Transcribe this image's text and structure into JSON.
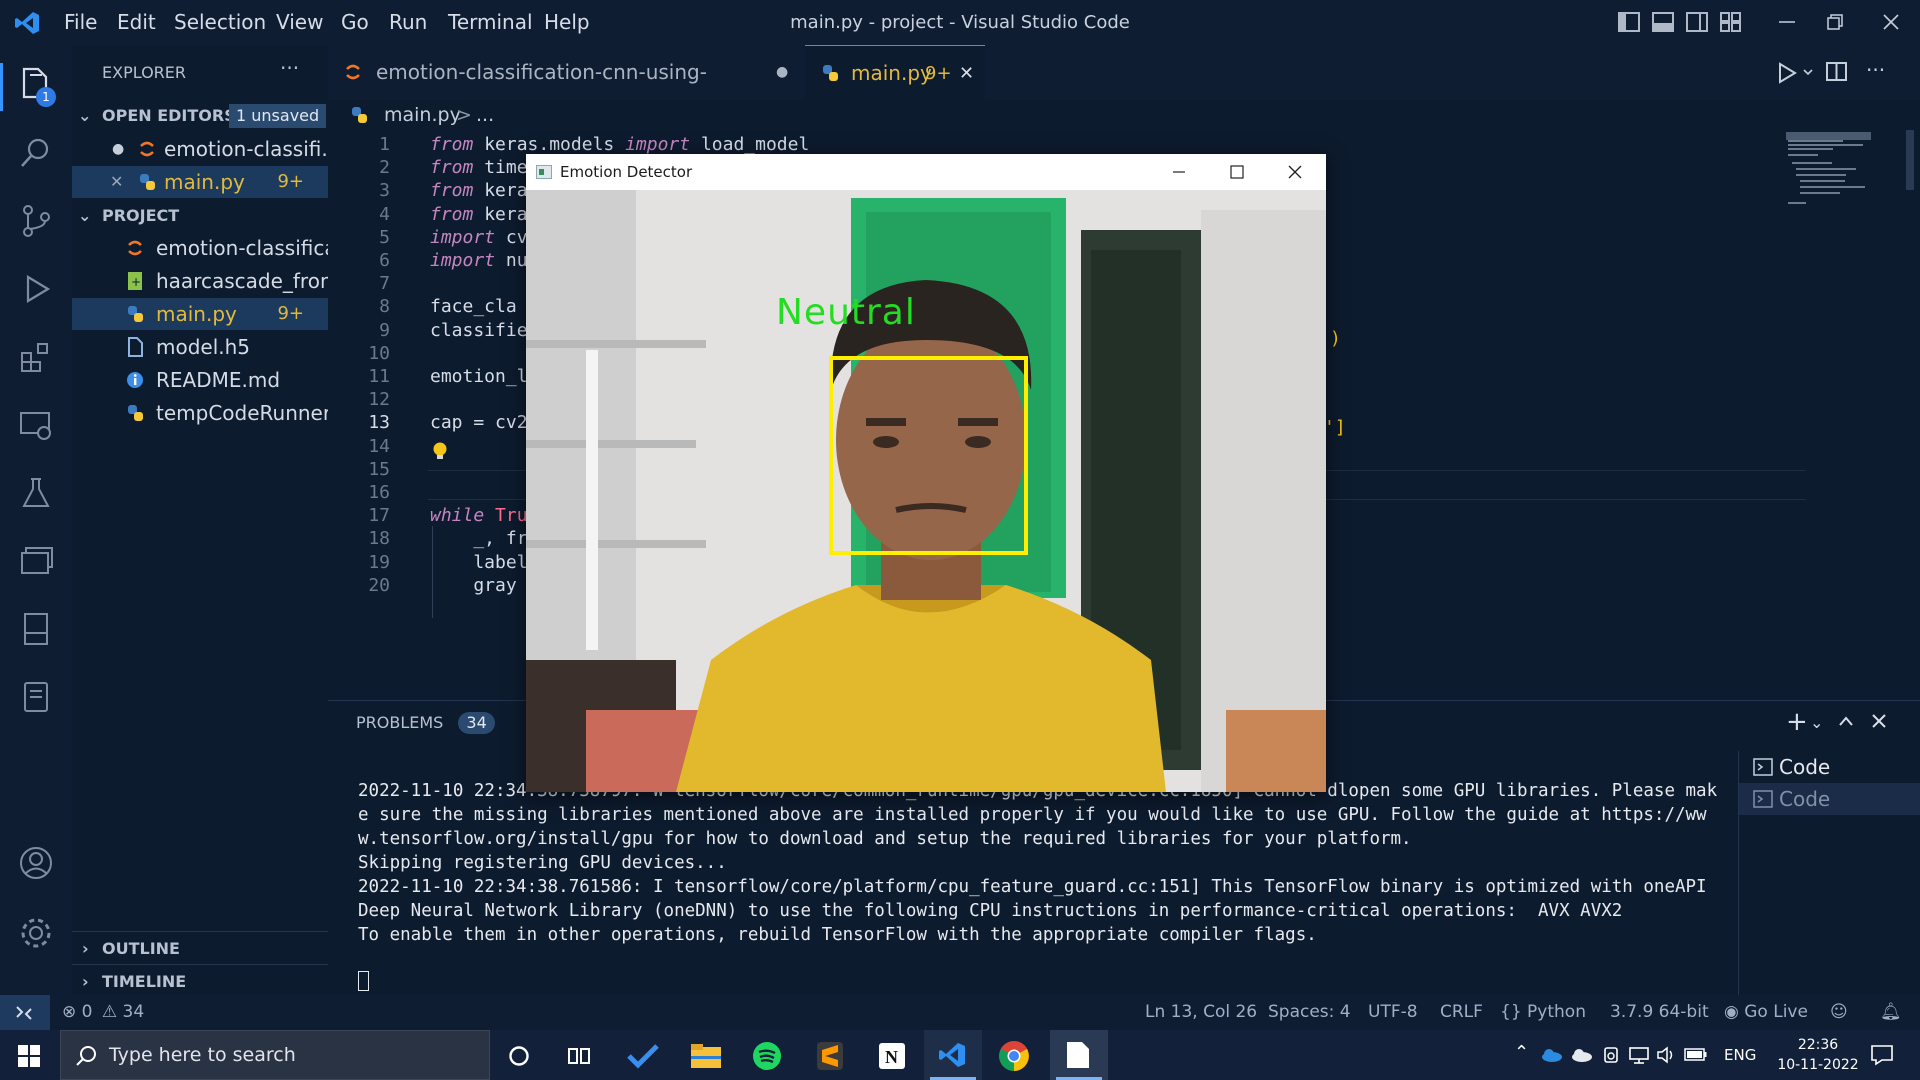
{
  "window": {
    "title": "main.py - project - Visual Studio Code",
    "menu": [
      "File",
      "Edit",
      "Selection",
      "View",
      "Go",
      "Run",
      "Terminal",
      "Help"
    ]
  },
  "explorer": {
    "title": "EXPLORER",
    "open_editors_label": "OPEN EDITORS",
    "unsaved_badge": "1 unsaved",
    "open_editors": [
      {
        "name": "emotion-classifi...",
        "badge": ""
      },
      {
        "name": "main.py",
        "badge": "9+"
      }
    ],
    "project_label": "PROJECT",
    "files": [
      {
        "name": "emotion-classifica...",
        "badge": ""
      },
      {
        "name": "haarcascade_fron...",
        "badge": ""
      },
      {
        "name": "main.py",
        "badge": "9+"
      },
      {
        "name": "model.h5",
        "badge": ""
      },
      {
        "name": "README.md",
        "badge": ""
      },
      {
        "name": "tempCodeRunner...",
        "badge": ""
      }
    ],
    "outline_label": "OUTLINE",
    "timeline_label": "TIMELINE",
    "activity_badge": "1"
  },
  "tabs": [
    {
      "label": "emotion-classification-cnn-using-keras.ipynb",
      "modified": "●"
    },
    {
      "label": "main.py",
      "badge": "9+",
      "close": "✕"
    }
  ],
  "breadcrumb": {
    "file": "main.py",
    "sep": ">",
    "rest": "..."
  },
  "code_lines": [
    {
      "n": "1",
      "kw": "from",
      "rest": " keras.models ",
      "kw2": "import",
      "rest2": " load_model"
    },
    {
      "n": "2",
      "kw": "from",
      "rest": " time",
      "kw2": "",
      "rest2": ""
    },
    {
      "n": "3",
      "kw": "from",
      "rest": " kera",
      "kw2": "",
      "rest2": ""
    },
    {
      "n": "4",
      "kw": "from",
      "rest": " kera",
      "kw2": "",
      "rest2": ""
    },
    {
      "n": "5",
      "kw": "import",
      "rest": " cv",
      "kw2": "",
      "rest2": ""
    },
    {
      "n": "6",
      "kw": "import",
      "rest": " nu",
      "kw2": "",
      "rest2": ""
    },
    {
      "n": "7",
      "kw": "",
      "rest": "",
      "kw2": "",
      "rest2": ""
    },
    {
      "n": "8",
      "kw": "",
      "rest": "face_cla",
      "kw2": "",
      "rest2": ""
    },
    {
      "n": "9",
      "kw": "",
      "rest": "classifie",
      "kw2": "",
      "rest2": ""
    },
    {
      "n": "10",
      "kw": "",
      "rest": "",
      "kw2": "",
      "rest2": ""
    },
    {
      "n": "11",
      "kw": "",
      "rest": "emotion_l",
      "kw2": "",
      "rest2": ""
    },
    {
      "n": "12",
      "kw": "",
      "rest": "",
      "kw2": "",
      "rest2": ""
    },
    {
      "n": "13",
      "kw": "",
      "rest": "cap = cv2",
      "kw2": "",
      "rest2": ""
    },
    {
      "n": "14",
      "kw": "",
      "rest": "",
      "kw2": "",
      "rest2": ""
    },
    {
      "n": "15",
      "kw": "",
      "rest": "",
      "kw2": "",
      "rest2": ""
    },
    {
      "n": "16",
      "kw": "",
      "rest": "",
      "kw2": "",
      "rest2": ""
    },
    {
      "n": "17",
      "kw": "while",
      "rest": " Tru",
      "kw2": "",
      "rest2": ""
    },
    {
      "n": "18",
      "kw": "",
      "rest": "    _, fr",
      "kw2": "",
      "rest2": ""
    },
    {
      "n": "19",
      "kw": "",
      "rest": "    label",
      "kw2": "",
      "rest2": ""
    },
    {
      "n": "20",
      "kw": "",
      "rest": "    gray",
      "kw2": "",
      "rest2": ""
    }
  ],
  "code_right_fragments": {
    "line8": ")",
    "line11": "']"
  },
  "panel": {
    "problems_label": "PROBLEMS",
    "problems_count": "34",
    "terminal_text": "2022-11-10 22:34:38.738797: W tensorflow/core/common_runtime/gpu/gpu_device.cc:1850] Cannot dlopen some GPU libraries. Please make sure the missing libraries mentioned above are installed properly if you would like to use GPU. Follow the guide at https://www.tensorflow.org/install/gpu for how to download and setup the required libraries for your platform.\nSkipping registering GPU devices...\n2022-11-10 22:34:38.761586: I tensorflow/core/platform/cpu_feature_guard.cc:151] This TensorFlow binary is optimized with oneAPI Deep Neural Network Library (oneDNN) to use the following CPU instructions in performance-critical operations:  AVX AVX2\nTo enable them in other operations, rebuild TensorFlow with the appropriate compiler flags.",
    "terminals": [
      "Code",
      "Code"
    ]
  },
  "status": {
    "errors": "0",
    "warnings": "34",
    "position": "Ln 13, Col 26",
    "spaces": "Spaces: 4",
    "encoding": "UTF-8",
    "eol": "CRLF",
    "language": "Python",
    "interpreter": "3.7.9 64-bit",
    "golive": "Go Live"
  },
  "emotion_window": {
    "title": "Emotion Detector",
    "label": "Neutral"
  },
  "taskbar": {
    "search_placeholder": "Type here to search",
    "lang": "ENG",
    "time": "22:36",
    "date": "10-11-2022"
  },
  "colors": {
    "accent": "#3794ff",
    "modified": "#e2b93d",
    "face_box": "#ffee00",
    "label": "#22dd22"
  }
}
